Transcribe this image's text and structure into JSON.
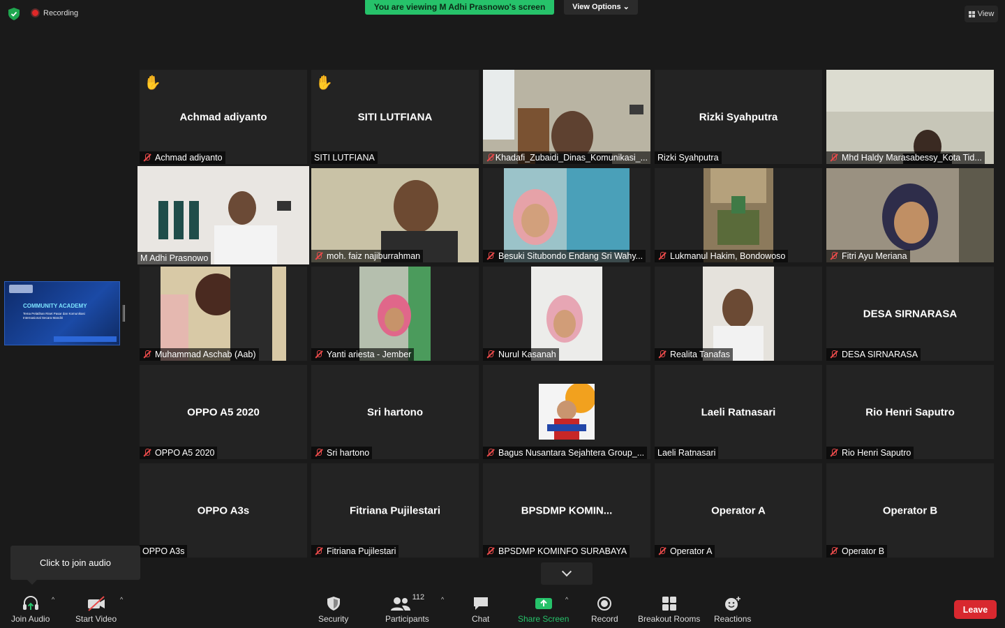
{
  "topbar": {
    "recording_label": "Recording",
    "viewing_banner": "You are viewing M Adhi Prasnowo's screen",
    "view_options_label": "View Options",
    "view_label": "View",
    "status_color": "#26c26a"
  },
  "shared_screen": {
    "title": "COMMUNITY ACADEMY",
    "subtitle": "Tema Pelatihan Riset Pasar dan Komunikasi Internasional Secara Mandiri"
  },
  "tiles": [
    {
      "name": "Achmad adiyanto",
      "label": "Achmad adiyanto",
      "muted": true,
      "hand": true
    },
    {
      "name": "SITI LUTFIANA",
      "label": "SITI LUTFIANA",
      "muted": false,
      "hand": true
    },
    {
      "label": "Khadafi_Zubaidi_Dinas_Komunikasi_...",
      "muted": true
    },
    {
      "name": "Rizki Syahputra",
      "label": "Rizki Syahputra",
      "muted": false
    },
    {
      "label": "Mhd Haldy Marasabessy_Kota Tid...",
      "muted": true
    },
    {
      "label": "M Adhi Prasnowo",
      "muted": false,
      "active": true
    },
    {
      "label": "moh. faiz najiburrahman",
      "muted": true
    },
    {
      "label": "Besuki Situbondo Endang Sri Wahy...",
      "muted": true
    },
    {
      "label": "Lukmanul Hakim, Bondowoso",
      "muted": true
    },
    {
      "label": "Fitri Ayu Meriana",
      "muted": true
    },
    {
      "label": "Muhammad Aschab (Aab)",
      "muted": true
    },
    {
      "label": "Yanti ariesta - Jember",
      "muted": true
    },
    {
      "label": "Nurul Kasanah",
      "muted": true
    },
    {
      "label": "Realita Tanafas",
      "muted": true
    },
    {
      "name": "DESA SIRNARASA",
      "label": "DESA SIRNARASA",
      "muted": true
    },
    {
      "name": "OPPO A5 2020",
      "label": "OPPO A5 2020",
      "muted": true
    },
    {
      "name": "Sri hartono",
      "label": "Sri hartono",
      "muted": true
    },
    {
      "label": "Bagus Nusantara Sejahtera Group_...",
      "muted": true
    },
    {
      "name": "Laeli Ratnasari",
      "label": "Laeli Ratnasari",
      "muted": false
    },
    {
      "name": "Rio Henri Saputro",
      "label": "Rio Henri Saputro",
      "muted": true
    },
    {
      "name": "OPPO A3s",
      "label": "OPPO A3s",
      "muted": false
    },
    {
      "name": "Fitriana Pujilestari",
      "label": "Fitriana Pujilestari",
      "muted": true
    },
    {
      "name": "BPSDMP  KOMIN...",
      "label": "BPSDMP KOMINFO SURABAYA",
      "muted": true
    },
    {
      "name": "Operator A",
      "label": "Operator A",
      "muted": true
    },
    {
      "name": "Operator B",
      "label": "Operator B",
      "muted": true
    }
  ],
  "join_tooltip": "Click to join audio",
  "toolbar": {
    "join_audio": "Join Audio",
    "start_video": "Start Video",
    "security": "Security",
    "participants": "Participants",
    "participants_count": "112",
    "chat": "Chat",
    "share_screen": "Share Screen",
    "record": "Record",
    "breakout_rooms": "Breakout Rooms",
    "reactions": "Reactions",
    "leave": "Leave",
    "leave_color": "#d8282f"
  }
}
